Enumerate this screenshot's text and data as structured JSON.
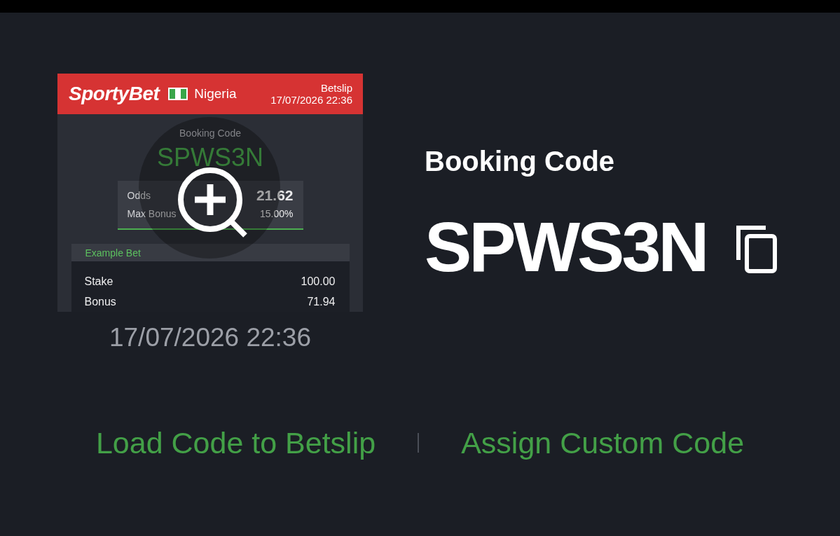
{
  "preview": {
    "header": {
      "logo": "SportyBet",
      "country": "Nigeria",
      "title": "Betslip",
      "datetime": "17/07/2026 22:36"
    },
    "booking_label": "Booking Code",
    "booking_code": "SPWS3N",
    "summary": [
      {
        "kind": "main",
        "label": "Odds",
        "value": "21.62"
      },
      {
        "kind": "minor",
        "label": "Max Bonus",
        "value": "15.00%"
      }
    ],
    "example_bet": {
      "title": "Example Bet",
      "rows": [
        {
          "label": "Stake",
          "value": "100.00"
        },
        {
          "label": "Bonus",
          "value": "71.94"
        }
      ]
    }
  },
  "preview_datetime": "17/07/2026 22:36",
  "booking": {
    "label": "Booking Code",
    "code": "SPWS3N"
  },
  "actions": [
    {
      "label": "Load Code to Betslip"
    },
    {
      "label": "Assign Custom Code"
    }
  ]
}
